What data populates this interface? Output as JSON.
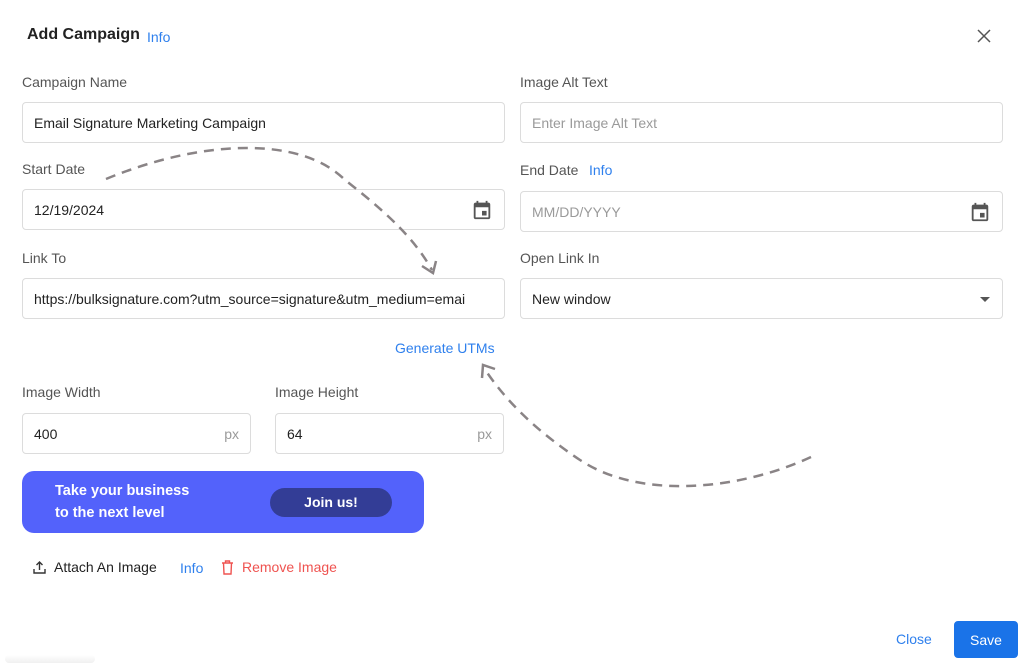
{
  "dialog": {
    "title": "Add Campaign",
    "title_info": "Info",
    "close_icon": "close-x-icon"
  },
  "fields": {
    "campaign_name": {
      "label": "Campaign Name",
      "value": "Email Signature Marketing Campaign"
    },
    "image_alt_text": {
      "label": "Image Alt Text",
      "placeholder": "Enter Image Alt Text"
    },
    "start_date": {
      "label": "Start Date",
      "value": "12/19/2024",
      "icon": "calendar-icon"
    },
    "end_date": {
      "label": "End Date",
      "info": "Info",
      "placeholder": "MM/DD/YYYY",
      "icon": "calendar-icon"
    },
    "link_to": {
      "label": "Link To",
      "value": "https://bulksignature.com?utm_source=signature&utm_medium=emai"
    },
    "open_link_in": {
      "label": "Open Link In",
      "value": "New window",
      "icon": "caret-down-icon"
    },
    "image_width": {
      "label": "Image Width",
      "value": "400",
      "unit": "px"
    },
    "image_height": {
      "label": "Image Height",
      "value": "64",
      "unit": "px"
    }
  },
  "generate_utms": "Generate UTMs",
  "banner": {
    "line1": "Take your business",
    "line2": "to the next level",
    "button": "Join us!",
    "bg_color": "#5362fb",
    "button_color": "#333d96"
  },
  "image_actions": {
    "attach": "Attach An Image",
    "info": "Info",
    "remove": "Remove Image"
  },
  "footer": {
    "close": "Close",
    "save": "Save"
  },
  "colors": {
    "accent": "#2f80ed",
    "primary_button": "#1a73e8",
    "danger": "#ef5350"
  }
}
